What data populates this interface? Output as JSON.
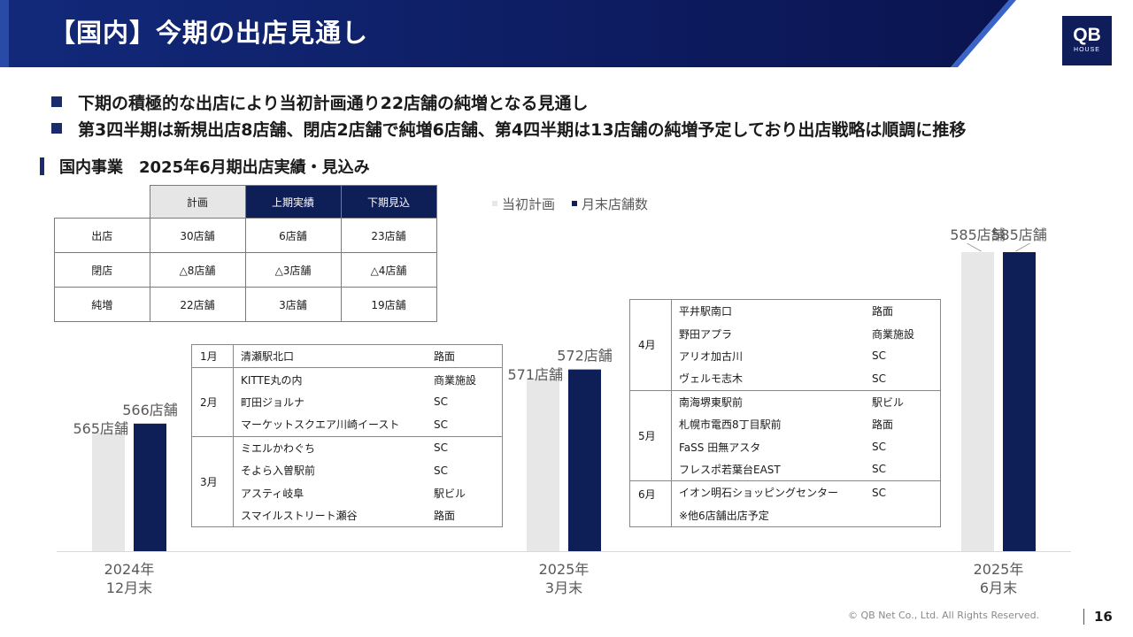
{
  "header": {
    "title": "【国内】今期の出店見通し",
    "logo_main": "QB",
    "logo_sub": "HOUSE"
  },
  "bullets": [
    "下期の積極的な出店により当初計画通り22店舗の純増となる見通し",
    "第3四半期は新規出店8店舗、閉店2店舗で純増6店舗、第4四半期は13店舗の純増予定しており出店戦略は順調に推移"
  ],
  "section_title": "国内事業　2025年6月期出店実績・見込み",
  "plan_table": {
    "headers": [
      "計画",
      "上期実績",
      "下期見込"
    ],
    "rows": [
      {
        "label": "出店",
        "cells": [
          "30店舗",
          "6店舗",
          "23店舗"
        ]
      },
      {
        "label": "閉店",
        "cells": [
          "△8店舗",
          "△3店舗",
          "△4店舗"
        ]
      },
      {
        "label": "純増",
        "cells": [
          "22店舗",
          "3店舗",
          "19店舗"
        ]
      }
    ]
  },
  "chart_data": {
    "type": "bar",
    "title": "",
    "xlabel": "",
    "ylabel": "",
    "categories": [
      [
        "2024年",
        "12月末"
      ],
      [
        "2025年",
        "3月末"
      ],
      [
        "2025年",
        "6月末"
      ]
    ],
    "series": [
      {
        "name": "当初計画",
        "color": "#e7e7e7",
        "values": [
          565,
          571,
          585
        ],
        "labels": [
          "565店舗",
          "571店舗",
          "585店舗"
        ]
      },
      {
        "name": "月末店舗数",
        "color": "#0e1e57",
        "values": [
          566,
          572,
          585
        ],
        "labels": [
          "566店舗",
          "572店舗",
          "585店舗"
        ]
      }
    ],
    "legend_position": "top",
    "grid": false
  },
  "q3_openings": [
    {
      "month": "1月",
      "stores": [
        {
          "name": "清瀬駅北口",
          "type": "路面"
        }
      ]
    },
    {
      "month": "2月",
      "stores": [
        {
          "name": "KITTE丸の内",
          "type": "商業施設"
        },
        {
          "name": "町田ジョルナ",
          "type": "SC"
        },
        {
          "name": "マーケットスクエア川崎イースト",
          "type": "SC"
        }
      ]
    },
    {
      "month": "3月",
      "stores": [
        {
          "name": "ミエルかわぐち",
          "type": "SC"
        },
        {
          "name": "そよら入曽駅前",
          "type": "SC"
        },
        {
          "name": "アスティ岐阜",
          "type": "駅ビル"
        },
        {
          "name": "スマイルストリート瀬谷",
          "type": "路面"
        }
      ]
    }
  ],
  "q4_openings": [
    {
      "month": "4月",
      "stores": [
        {
          "name": "平井駅南口",
          "type": "路面"
        },
        {
          "name": "野田アプラ",
          "type": "商業施設"
        },
        {
          "name": "アリオ加古川",
          "type": "SC"
        },
        {
          "name": "ヴェルモ志木",
          "type": "SC"
        }
      ]
    },
    {
      "month": "5月",
      "stores": [
        {
          "name": "南海堺東駅前",
          "type": "駅ビル"
        },
        {
          "name": "札幌市電西8丁目駅前",
          "type": "路面"
        },
        {
          "name": "FaSS 田無アスタ",
          "type": "SC"
        },
        {
          "name": "フレスポ若葉台EAST",
          "type": "SC"
        }
      ]
    },
    {
      "month": "6月",
      "stores": [
        {
          "name": "イオン明石ショッピングセンター",
          "type": "SC"
        },
        {
          "name": "※他6店舗出店予定",
          "type": ""
        }
      ]
    }
  ],
  "footer": {
    "copyright": "© QB Net Co., Ltd. All Rights Reserved.",
    "page": "16"
  }
}
